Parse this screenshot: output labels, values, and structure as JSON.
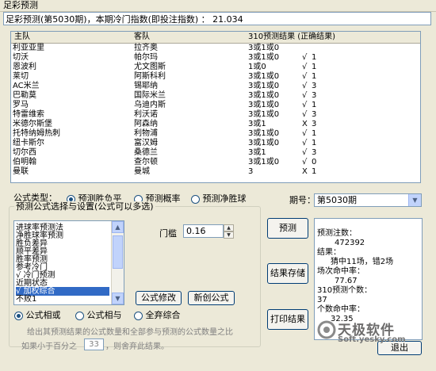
{
  "window": {
    "title": "足彩预测"
  },
  "info": {
    "text": "足彩预测(第5030期)，本期冷门指数(即投注指数) ： 21.034"
  },
  "table": {
    "columns": [
      "主队",
      "客队",
      "310预测结果 (正确结果)"
    ],
    "rows": [
      {
        "home": "利亚亚里",
        "away": "拉齐奥",
        "pred": "3或1或0",
        "check": "",
        "result": ""
      },
      {
        "home": "切沃",
        "away": "帕尔玛",
        "pred": "3或1或0",
        "check": "√",
        "result": "1"
      },
      {
        "home": "恩波利",
        "away": "尤文图斯",
        "pred": "1或0",
        "check": "√",
        "result": "1"
      },
      {
        "home": "莱切",
        "away": "阿斯科利",
        "pred": "3或1或0",
        "check": "√",
        "result": "1"
      },
      {
        "home": "AC米兰",
        "away": "锡耶纳",
        "pred": "3或1或0",
        "check": "√",
        "result": "3"
      },
      {
        "home": "巴勒莫",
        "away": "国际米兰",
        "pred": "3或1或0",
        "check": "√",
        "result": "3"
      },
      {
        "home": "罗马",
        "away": "乌迪内斯",
        "pred": "3或1或0",
        "check": "√",
        "result": "1"
      },
      {
        "home": "特雷维索",
        "away": "利沃诺",
        "pred": "3或1或0",
        "check": "√",
        "result": "3"
      },
      {
        "home": "米德尔斯堡",
        "away": "阿森纳",
        "pred": "3或1",
        "check": "X",
        "result": "3"
      },
      {
        "home": "托特纳姆热刺",
        "away": "利物浦",
        "pred": "3或1或0",
        "check": "√",
        "result": "1"
      },
      {
        "home": "纽卡斯尔",
        "away": "富汉姆",
        "pred": "3或1或0",
        "check": "√",
        "result": "1"
      },
      {
        "home": "切尔西",
        "away": "桑德兰",
        "pred": "3或1",
        "check": "√",
        "result": "3"
      },
      {
        "home": "伯明翰",
        "away": "查尔顿",
        "pred": "3或1或0",
        "check": "√",
        "result": "0"
      },
      {
        "home": "曼联",
        "away": "曼城",
        "pred": "3",
        "check": "X",
        "result": "1"
      }
    ]
  },
  "formula_type": {
    "label": "公式类型：",
    "options": [
      "预测胜负平",
      "预测概率",
      "预测净胜球"
    ],
    "selected": "预测胜负平"
  },
  "period": {
    "label": "期号：",
    "value": "第5030期"
  },
  "formula_group": {
    "legend": "预测公式选择与设置(公式可以多选)",
    "items": [
      "进球率预测法",
      "净胜球率预测",
      "胜负差异",
      "顺平差异",
      "胜率预测",
      "参考冷门",
      "√ 冷门预测",
      "近期状态",
      "√ 加权综合",
      "不败1"
    ],
    "selected_index": 8,
    "threshold_label": "门槛",
    "threshold_value": "0.16",
    "edit_button": "公式修改",
    "new_button": "新创公式",
    "mode_options": [
      "公式相或",
      "公式相与",
      "全弃综合"
    ],
    "mode_selected": "公式相或",
    "desc_part1": "给出其预测结果的公式数量和全部参与预测的公式数量之比",
    "desc_part2": "如果小于百分之",
    "desc_number": "33",
    "desc_part3": "，则舍弃此结果。"
  },
  "buttons": {
    "predict": "预测",
    "save": "结果存储",
    "print": "打印结果",
    "exit": "退出"
  },
  "results": {
    "count_label": "预测注数：",
    "count_value": "472392",
    "result_label": "结果：",
    "hit_text": "猜中11场，错2场",
    "match_rate_label": "场次命中率：",
    "match_rate_value": "77.67",
    "n310_label": "310预测个数：",
    "n310_value": "37",
    "number_rate_label": "个数命中率：",
    "number_rate_value": "32.35"
  },
  "watermark": {
    "brand": "天极软件",
    "url": "Soft.yesky.com"
  }
}
